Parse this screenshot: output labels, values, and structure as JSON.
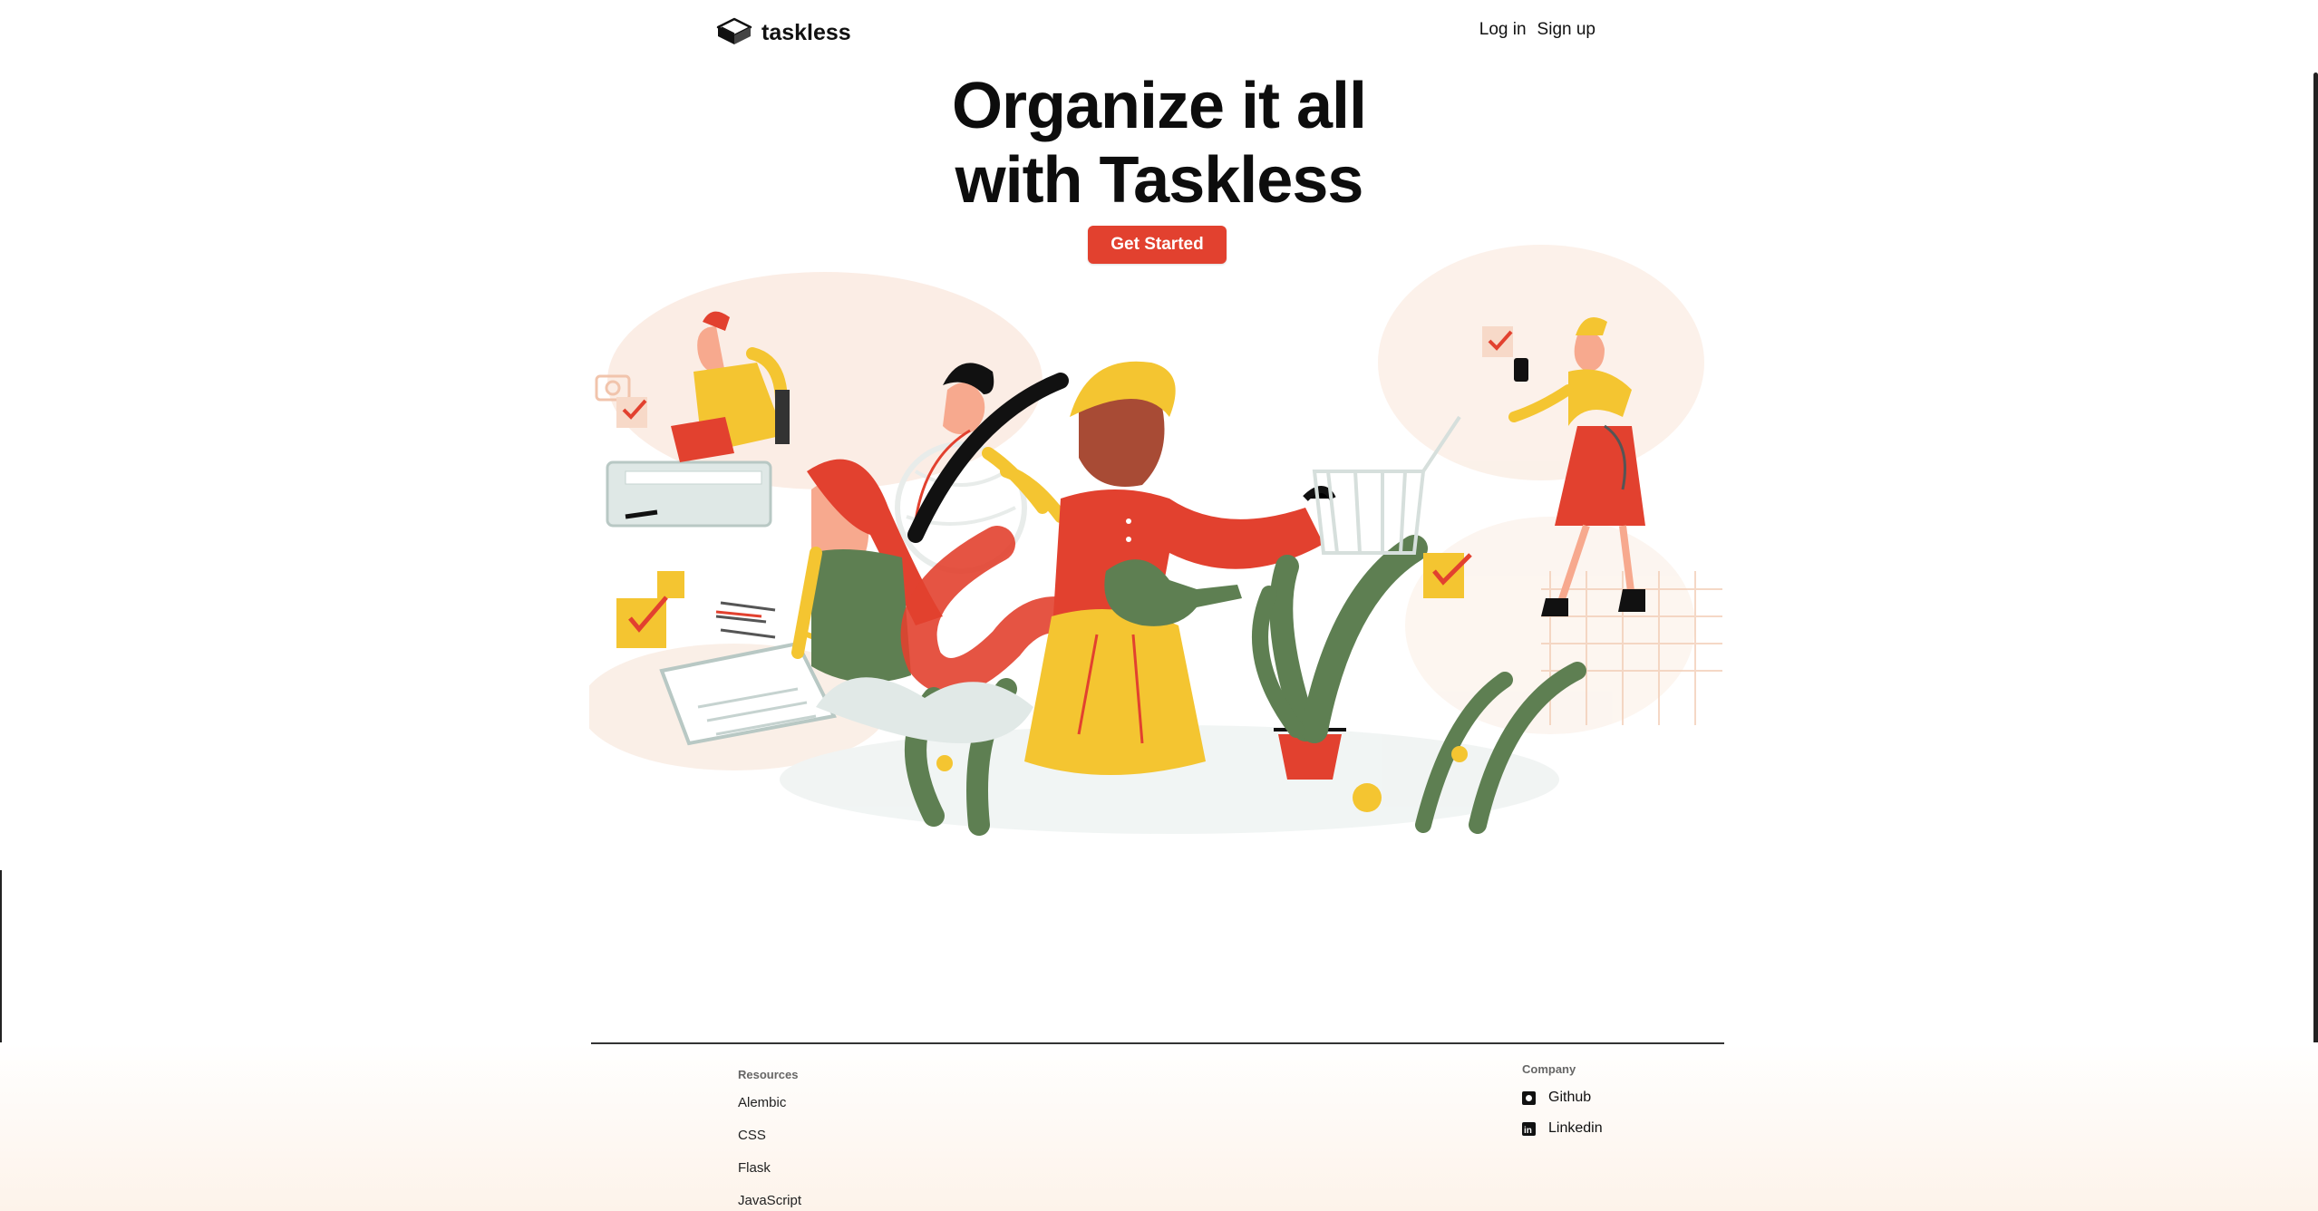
{
  "nav": {
    "brand": "taskless",
    "login": "Log in",
    "signup": "Sign up"
  },
  "hero": {
    "title_line1": "Organize it all",
    "title_line2": "with Taskless",
    "cta": "Get Started"
  },
  "footer": {
    "resources": {
      "title": "Resources",
      "links": [
        "Alembic",
        "CSS",
        "Flask",
        "JavaScript"
      ]
    },
    "company": {
      "title": "Company",
      "links": [
        {
          "label": "Github",
          "icon": "github-icon"
        },
        {
          "label": "Linkedin",
          "icon": "linkedin-icon"
        }
      ]
    }
  },
  "colors": {
    "accent": "#e2412f",
    "yellow": "#f4c531",
    "green": "#5e7f52",
    "peach": "#f6dccb"
  }
}
